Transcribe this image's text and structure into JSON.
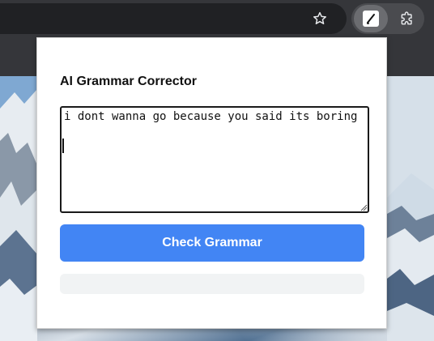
{
  "browser": {
    "toolbar": {
      "bookmark_icon": "star-icon",
      "extension_icon": "pen-icon",
      "extensions_menu_icon": "puzzle-icon"
    },
    "background": {
      "image": "snowy-mountains"
    }
  },
  "popup": {
    "title": "AI Grammar Corrector",
    "input": {
      "value": "i dont wanna go because you said its boring",
      "placeholder": ""
    },
    "check_button_label": "Check Grammar",
    "result_text": ""
  },
  "colors": {
    "toolbar_bg": "#35363a",
    "omnibox_bg": "#202124",
    "accent_button": "#4285f4",
    "result_bg": "#f1f3f4"
  }
}
